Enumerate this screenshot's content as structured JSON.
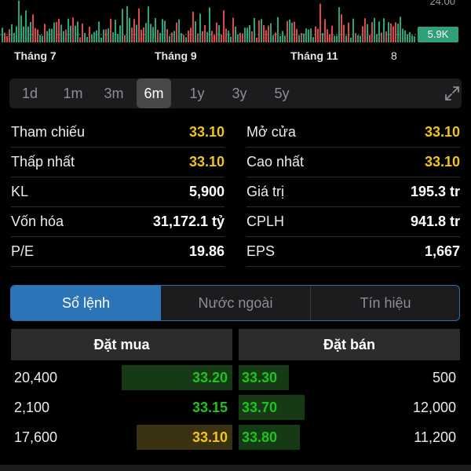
{
  "volume": {
    "axis_label": "24.00",
    "badge": "5.9K",
    "months": [
      "Tháng 7",
      "Tháng 9",
      "Tháng 11",
      "8"
    ]
  },
  "ranges": {
    "items": [
      "1d",
      "1m",
      "3m",
      "6m",
      "1y",
      "3y",
      "5y"
    ],
    "active": "6m"
  },
  "stats": {
    "left": [
      {
        "label": "Tham chiếu",
        "value": "33.10",
        "color": "yellow"
      },
      {
        "label": "Thấp nhất",
        "value": "33.10",
        "color": "yellow"
      },
      {
        "label": "KL",
        "value": "5,900",
        "color": "white"
      },
      {
        "label": "Vốn hóa",
        "value": "31,172.1 tỷ",
        "color": "white"
      },
      {
        "label": "P/E",
        "value": "19.86",
        "color": "white"
      }
    ],
    "right": [
      {
        "label": "Mở cửa",
        "value": "33.10",
        "color": "yellow"
      },
      {
        "label": "Cao nhất",
        "value": "33.10",
        "color": "yellow"
      },
      {
        "label": "Giá trị",
        "value": "195.3 tr",
        "color": "white"
      },
      {
        "label": "CPLH",
        "value": "941.8 tr",
        "color": "white"
      },
      {
        "label": "EPS",
        "value": "1,667",
        "color": "white"
      }
    ]
  },
  "tabs": {
    "items": [
      "Sổ lệnh",
      "Nước ngoài",
      "Tín hiệu"
    ],
    "active": "Sổ lệnh"
  },
  "orderbook": {
    "buy_header": "Đặt mua",
    "sell_header": "Đặt bán",
    "rows": [
      {
        "buy_qty": "20,400",
        "buy_price": "33.20",
        "buy_color": "green",
        "sell_price": "33.30",
        "sell_color": "green",
        "sell_qty": "500"
      },
      {
        "buy_qty": "2,100",
        "buy_price": "33.15",
        "buy_color": "green",
        "sell_price": "33.70",
        "sell_color": "green",
        "sell_qty": "12,000"
      },
      {
        "buy_qty": "17,600",
        "buy_price": "33.10",
        "buy_color": "yellow",
        "sell_price": "33.80",
        "sell_color": "green",
        "sell_qty": "11,200"
      }
    ]
  },
  "colors": {
    "up": "#1ec31e",
    "ref": "#f0c419",
    "down": "#e04848",
    "accent": "#2b74b8",
    "badge": "#2fa07a"
  }
}
